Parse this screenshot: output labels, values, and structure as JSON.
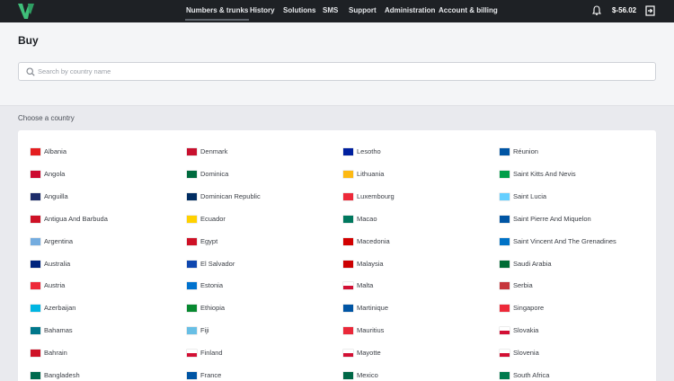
{
  "topbar": {
    "nav": [
      {
        "label": "Numbers & trunks",
        "active": true
      },
      {
        "label": "History",
        "active": false
      },
      {
        "label": "Solutions",
        "active": false
      },
      {
        "label": "SMS",
        "active": false
      },
      {
        "label": "Support",
        "active": false
      },
      {
        "label": "Administration",
        "active": false
      },
      {
        "label": "Account & billing",
        "active": false
      }
    ],
    "balance": "$-56.02",
    "icons": {
      "logo": "brand-logo-icon",
      "notifications": "bell-icon",
      "logout": "logout-icon"
    }
  },
  "page": {
    "title": "Buy",
    "search": {
      "value": "",
      "placeholder": "Search by country name",
      "icon": "search-icon"
    },
    "section_label": "Choose a country"
  },
  "countries": [
    [
      "Albania",
      "Angola",
      "Anguilla",
      "Antigua And Barbuda",
      "Argentina",
      "Australia",
      "Austria",
      "Azerbaijan",
      "Bahamas",
      "Bahrain",
      "Bangladesh"
    ],
    [
      "Denmark",
      "Dominica",
      "Dominican Republic",
      "Ecuador",
      "Egypt",
      "El Salvador",
      "Estonia",
      "Ethiopia",
      "Fiji",
      "Finland",
      "France"
    ],
    [
      "Lesotho",
      "Lithuania",
      "Luxembourg",
      "Macao",
      "Macedonia",
      "Malaysia",
      "Malta",
      "Martinique",
      "Mauritius",
      "Mayotte",
      "Mexico"
    ],
    [
      "Réunion",
      "Saint Kitts And Nevis",
      "Saint Lucia",
      "Saint Pierre And Miquelon",
      "Saint Vincent And The Grenadines",
      "Saudi Arabia",
      "Serbia",
      "Singapore",
      "Slovakia",
      "Slovenia",
      "South Africa"
    ]
  ],
  "flag_colors": [
    [
      "#e41e20",
      "#cc092f",
      "#1d2d6b",
      "#ce1126",
      "#74acdf",
      "#00247d",
      "#ed2939",
      "#00b5e2",
      "#00778b",
      "#ce1126",
      "#006a4e"
    ],
    [
      "#c8102e",
      "#006b3f",
      "#002d62",
      "#ffd100",
      "#ce1126",
      "#0f47af",
      "#0072ce",
      "#078930",
      "#68bfe5",
      "#ffffff",
      "#0055a4"
    ],
    [
      "#00209f",
      "#fdb913",
      "#ed2939",
      "#00785e",
      "#d20000",
      "#cc0001",
      "#ffffff",
      "#0055a4",
      "#ea2839",
      "#ffffff",
      "#006847"
    ],
    [
      "#0055a4",
      "#009e49",
      "#65cfff",
      "#0055a4",
      "#0072c6",
      "#006c35",
      "#c6363c",
      "#ed2939",
      "#ffffff",
      "#ffffff",
      "#007a4d"
    ]
  ]
}
